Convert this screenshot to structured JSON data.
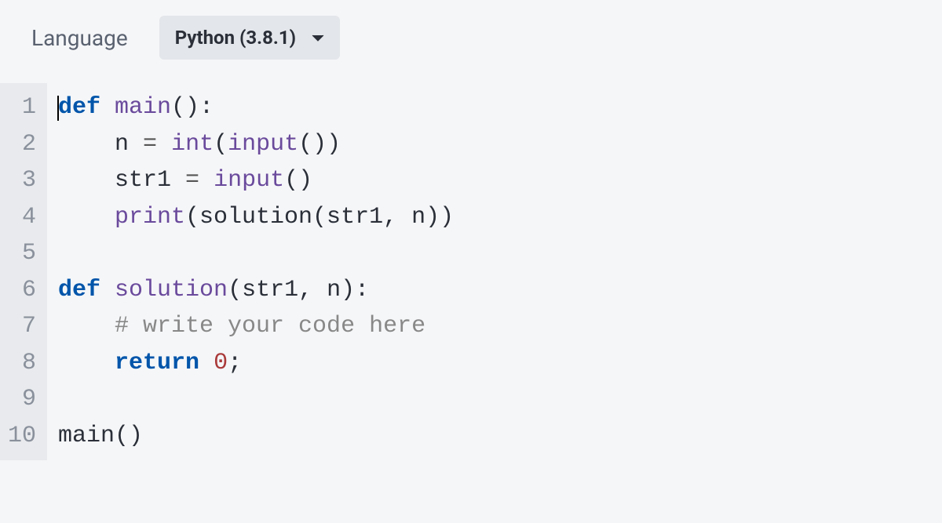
{
  "header": {
    "label": "Language",
    "language": "Python (3.8.1)"
  },
  "code": {
    "lines": [
      {
        "num": "1",
        "tokens": [
          {
            "t": "kw",
            "v": "def"
          },
          {
            "t": "",
            "v": " "
          },
          {
            "t": "fn",
            "v": "main"
          },
          {
            "t": "",
            "v": "():"
          }
        ]
      },
      {
        "num": "2",
        "tokens": [
          {
            "t": "",
            "v": "    n "
          },
          {
            "t": "op",
            "v": "="
          },
          {
            "t": "",
            "v": " "
          },
          {
            "t": "builtin",
            "v": "int"
          },
          {
            "t": "",
            "v": "("
          },
          {
            "t": "builtin",
            "v": "input"
          },
          {
            "t": "",
            "v": "())"
          }
        ]
      },
      {
        "num": "3",
        "tokens": [
          {
            "t": "",
            "v": "    str1 "
          },
          {
            "t": "op",
            "v": "="
          },
          {
            "t": "",
            "v": " "
          },
          {
            "t": "builtin",
            "v": "input"
          },
          {
            "t": "",
            "v": "()"
          }
        ]
      },
      {
        "num": "4",
        "tokens": [
          {
            "t": "",
            "v": "    "
          },
          {
            "t": "builtin",
            "v": "print"
          },
          {
            "t": "",
            "v": "(solution(str1, n))"
          }
        ]
      },
      {
        "num": "5",
        "tokens": [
          {
            "t": "",
            "v": ""
          }
        ]
      },
      {
        "num": "6",
        "tokens": [
          {
            "t": "kw",
            "v": "def"
          },
          {
            "t": "",
            "v": " "
          },
          {
            "t": "fn",
            "v": "solution"
          },
          {
            "t": "",
            "v": "(str1, n):"
          }
        ]
      },
      {
        "num": "7",
        "tokens": [
          {
            "t": "",
            "v": "    "
          },
          {
            "t": "comment",
            "v": "# write your code here"
          }
        ]
      },
      {
        "num": "8",
        "tokens": [
          {
            "t": "",
            "v": "    "
          },
          {
            "t": "kw",
            "v": "return"
          },
          {
            "t": "",
            "v": " "
          },
          {
            "t": "num",
            "v": "0"
          },
          {
            "t": "",
            "v": ";"
          }
        ]
      },
      {
        "num": "9",
        "tokens": [
          {
            "t": "",
            "v": ""
          }
        ]
      },
      {
        "num": "10",
        "tokens": [
          {
            "t": "",
            "v": "main()"
          }
        ]
      }
    ]
  }
}
